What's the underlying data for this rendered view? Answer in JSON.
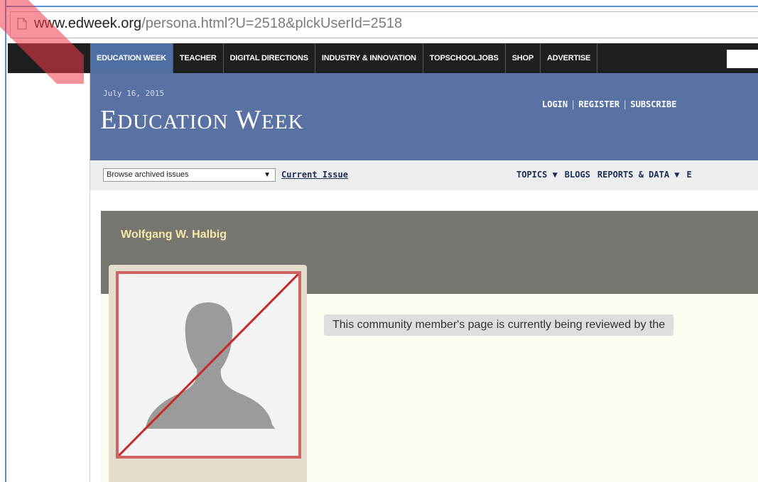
{
  "browser": {
    "url_domain": "www.edweek.org",
    "url_path": "/persona.html?U=2518&plckUserId=2518"
  },
  "topnav": {
    "items": [
      {
        "label": "EDUCATION WEEK",
        "active": true
      },
      {
        "label": "TEACHER"
      },
      {
        "label": "DIGITAL DIRECTIONS"
      },
      {
        "label": "INDUSTRY & INNOVATION"
      },
      {
        "label": "TOPSCHOOLJOBS"
      },
      {
        "label": "SHOP"
      },
      {
        "label": "ADVERTISE"
      }
    ]
  },
  "header": {
    "date": "July 16, 2015",
    "logo_first_initial": "E",
    "logo_first_rest": "DUCATION",
    "logo_second_initial": "W",
    "logo_second_rest": "EEK",
    "login": "LOGIN",
    "register": "REGISTER",
    "subscribe": "SUBSCRIBE",
    "separator": "|"
  },
  "subnav": {
    "archive_select": "Browse archived issues",
    "current_issue": "Current Issue",
    "topics": "TOPICS ▼",
    "blogs": "BLOGS",
    "reports": "REPORTS & DATA ▼",
    "truncated": "E"
  },
  "profile": {
    "name": "Wolfgang W. Halbig",
    "notice": "This community member's page is currently being reviewed by the"
  },
  "colors": {
    "header_blue": "#5a72a3",
    "profile_gray": "#767570",
    "name_yellow": "#f4e8a8",
    "frame_red": "#d06464"
  }
}
